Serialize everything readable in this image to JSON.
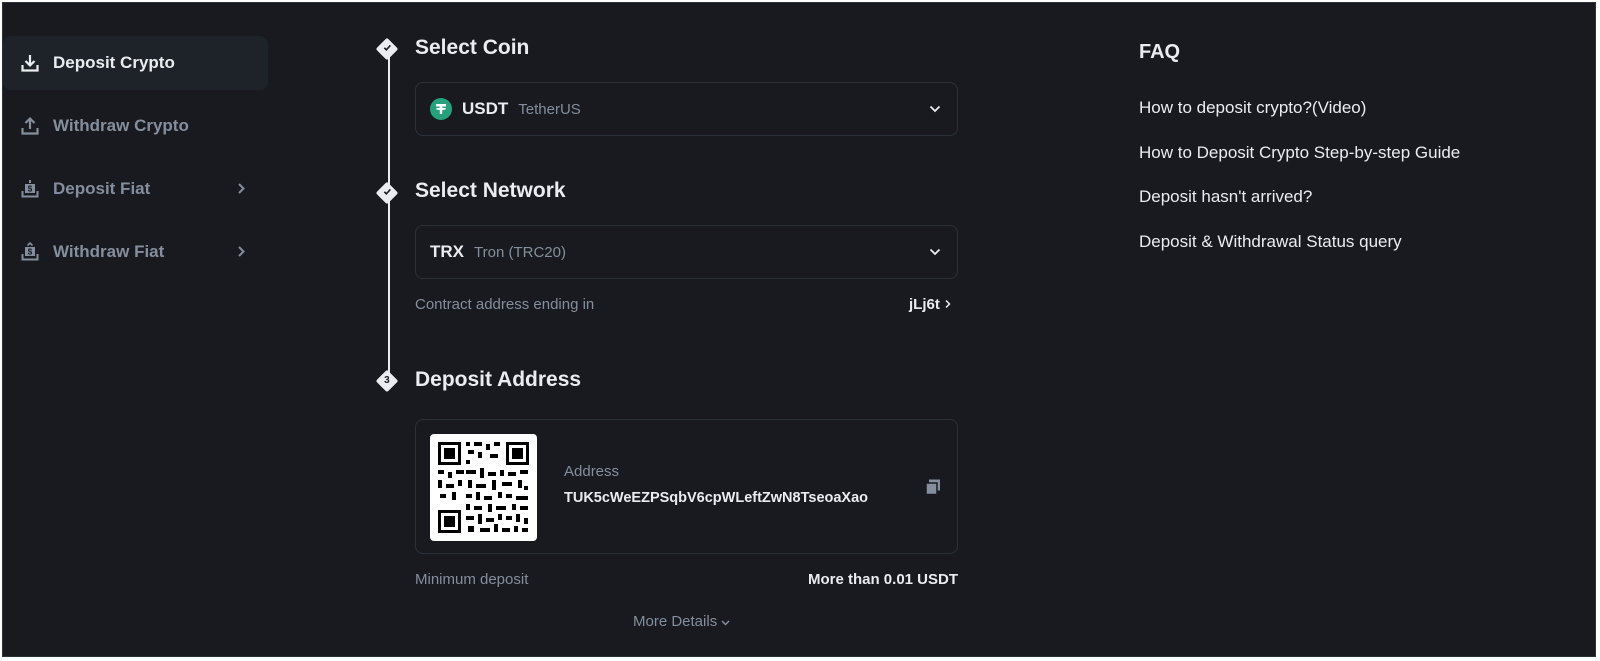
{
  "sidebar": {
    "items": [
      {
        "label": "Deposit Crypto",
        "icon": "download-icon",
        "active": true
      },
      {
        "label": "Withdraw Crypto",
        "icon": "upload-icon",
        "active": false
      },
      {
        "label": "Deposit Fiat",
        "icon": "deposit-fiat-icon",
        "active": false
      },
      {
        "label": "Withdraw Fiat",
        "icon": "withdraw-fiat-icon",
        "active": false
      }
    ]
  },
  "steps": {
    "coin": {
      "title": "Select Coin",
      "symbol": "USDT",
      "name": "TetherUS",
      "icon_color": "#26a17b"
    },
    "network": {
      "title": "Select Network",
      "symbol": "TRX",
      "name": "Tron (TRC20)",
      "contract_label": "Contract address ending in",
      "contract_value": "jLj6t"
    },
    "address": {
      "step_number": "3",
      "title": "Deposit Address",
      "address_label": "Address",
      "address_value": "TUK5cWeEZPSqbV6cpWLeftZwN8TseoaXao",
      "min_label": "Minimum deposit",
      "min_value": "More than 0.01 USDT",
      "more_details": "More Details"
    }
  },
  "faq": {
    "title": "FAQ",
    "links": [
      "How to deposit crypto?(Video)",
      "How to Deposit Crypto Step-by-step Guide",
      "Deposit hasn't arrived?",
      "Deposit & Withdrawal Status query"
    ]
  },
  "colors": {
    "background": "#181a20",
    "panel": "#1e2329",
    "border": "#2b3139",
    "text_primary": "#eaecef",
    "text_secondary": "#848e9c"
  }
}
